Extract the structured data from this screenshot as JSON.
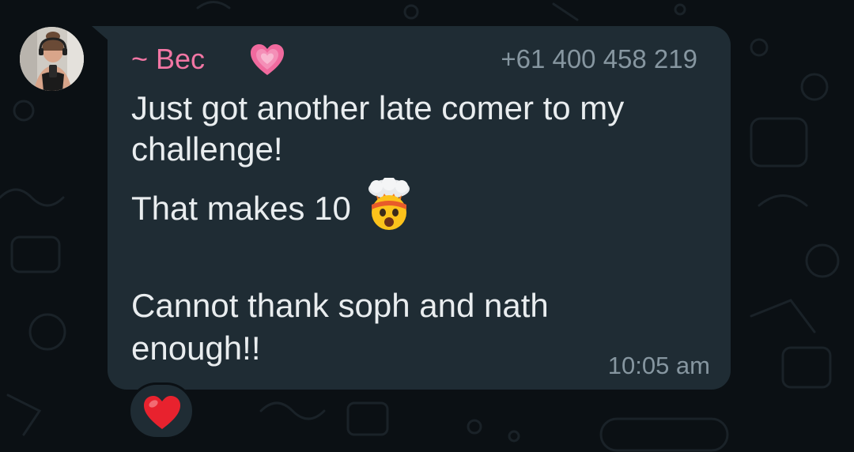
{
  "message": {
    "sender_name": "~ Bec",
    "sender_phone": "+61 400 458 219",
    "text_lines": [
      "Just got another late comer to my",
      "challenge!",
      "That makes 10",
      "Cannot thank soph and nath",
      "enough!!"
    ],
    "time": "10:05 am",
    "emojis": {
      "after_name": "growing-heart-icon",
      "after_line_3": "exploding-head-icon"
    },
    "reaction": "red-heart-icon"
  },
  "colors": {
    "background": "#0b1014",
    "bubble": "#1f2c34",
    "sender_name": "#f276a4",
    "text": "#e9edef",
    "meta": "#8696a0"
  }
}
